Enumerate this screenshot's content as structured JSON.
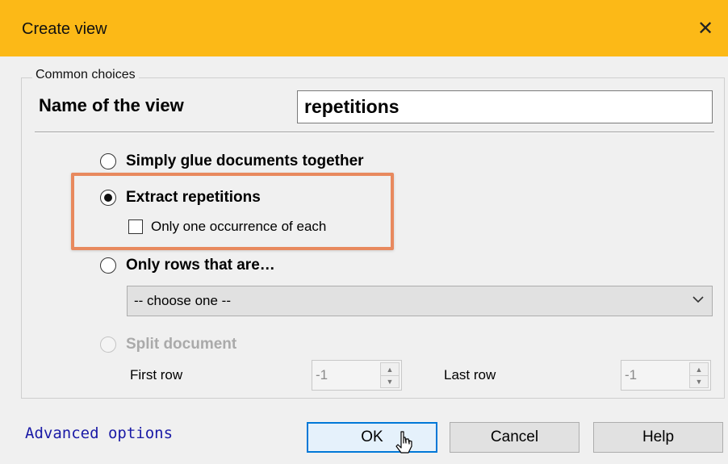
{
  "window": {
    "title": "Create view",
    "close_glyph": "✕",
    "titlebar_color": "#fcb917"
  },
  "group": {
    "legend": "Common choices"
  },
  "name_field": {
    "label": "Name of the view",
    "value": "repetitions"
  },
  "options": {
    "glue": {
      "label": "Simply glue documents together",
      "selected": false
    },
    "repetitions": {
      "label": "Extract repetitions",
      "selected": true
    },
    "only_one": {
      "label": "Only one occurrence of each",
      "checked": false
    },
    "rows": {
      "label": "Only rows that are…",
      "selected": false
    },
    "split": {
      "label": "Split document",
      "selected": false,
      "disabled": true
    }
  },
  "rows_select": {
    "value": "-- choose one --"
  },
  "split_fields": {
    "first_row_label": "First row",
    "first_row_value": "-1",
    "last_row_label": "Last row",
    "last_row_value": "-1"
  },
  "footer": {
    "advanced_link": "Advanced options",
    "ok_label": "OK",
    "cancel_label": "Cancel",
    "help_label": "Help"
  },
  "annotation": {
    "highlight_color": "#e8895e"
  },
  "icons": {
    "close": "close-icon",
    "dropdown": "chevron-down-icon",
    "spin_up": "spin-up-icon",
    "spin_down": "spin-down-icon",
    "cursor": "mouse-pointer-icon"
  }
}
